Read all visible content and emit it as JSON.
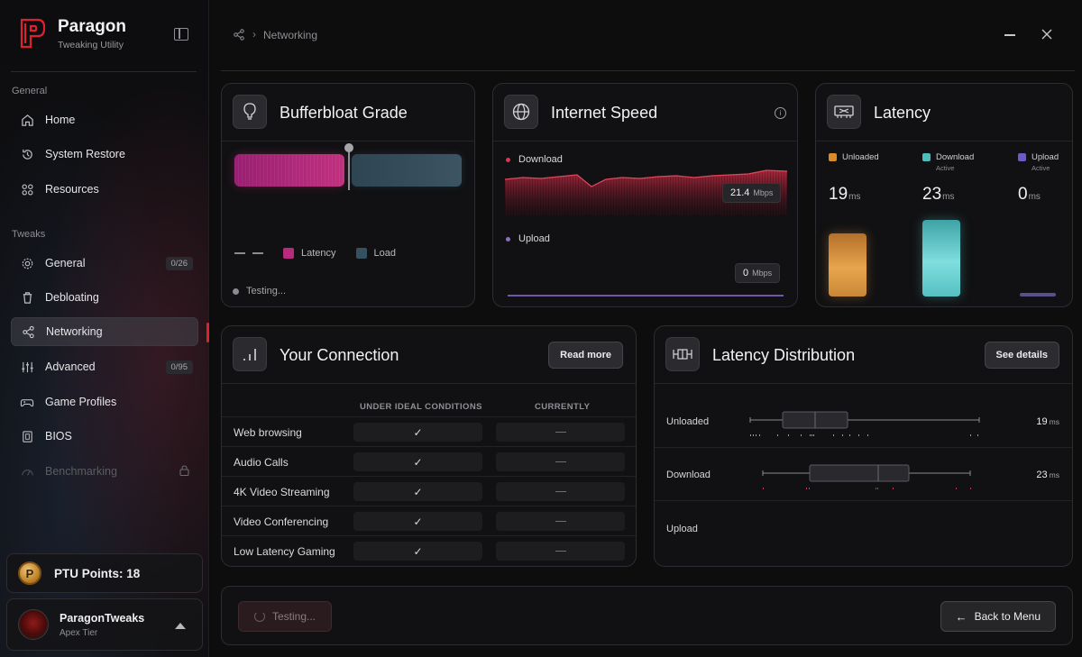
{
  "brand": {
    "title": "Paragon",
    "subtitle": "Tweaking Utility",
    "accent": "#e0212d"
  },
  "sidebar": {
    "sections": [
      {
        "label": "General"
      },
      {
        "label": "Tweaks"
      }
    ],
    "items": [
      {
        "label": "Home",
        "icon": "home-icon"
      },
      {
        "label": "System Restore",
        "icon": "restore-icon"
      },
      {
        "label": "Resources",
        "icon": "grid-icon"
      },
      {
        "label": "General",
        "icon": "gear-icon",
        "badge": "0/26"
      },
      {
        "label": "Debloating",
        "icon": "trash-icon"
      },
      {
        "label": "Networking",
        "icon": "share-icon",
        "active": true
      },
      {
        "label": "Advanced",
        "icon": "sliders-icon",
        "badge": "0/95"
      },
      {
        "label": "Game Profiles",
        "icon": "gamepad-icon"
      },
      {
        "label": "BIOS",
        "icon": "chip-icon"
      },
      {
        "label": "Benchmarking",
        "icon": "gauge-icon",
        "locked": true
      }
    ],
    "points": {
      "label": "PTU Points: 18",
      "coin": "P"
    },
    "user": {
      "name": "ParagonTweaks",
      "tier": "Apex Tier"
    }
  },
  "breadcrumb": {
    "icon": "share-icon",
    "separator": "›",
    "current": "Networking"
  },
  "bufferbloat": {
    "title": "Bufferbloat Grade",
    "legend": {
      "latency": "Latency",
      "load": "Load"
    },
    "status": "Testing...",
    "colors": {
      "latency": "#b72a7c",
      "load": "#35505e"
    }
  },
  "speed": {
    "title": "Internet Speed",
    "download": {
      "label": "Download",
      "value": "21.4",
      "unit": "Mbps",
      "color": "#e0344c"
    },
    "upload": {
      "label": "Upload",
      "value": "0",
      "unit": "Mbps",
      "color": "#8b6cc7"
    }
  },
  "latency": {
    "title": "Latency",
    "columns": [
      {
        "label": "Unloaded",
        "sub": "",
        "value": "19",
        "unit": "ms",
        "color": "#d98a2b"
      },
      {
        "label": "Download",
        "sub": "Active",
        "value": "23",
        "unit": "ms",
        "color": "#4fbcbc"
      },
      {
        "label": "Upload",
        "sub": "Active",
        "value": "0",
        "unit": "ms",
        "color": "#6b5bc4"
      }
    ]
  },
  "connection": {
    "title": "Your Connection",
    "read_more": "Read more",
    "col_ideal": "UNDER IDEAL CONDITIONS",
    "col_current": "CURRENTLY",
    "rows": [
      {
        "label": "Web browsing",
        "ideal": "✓"
      },
      {
        "label": "Audio Calls",
        "ideal": "✓"
      },
      {
        "label": "4K Video Streaming",
        "ideal": "✓"
      },
      {
        "label": "Video Conferencing",
        "ideal": "✓"
      },
      {
        "label": "Low Latency Gaming",
        "ideal": "✓"
      }
    ]
  },
  "distribution": {
    "title": "Latency Distribution",
    "see_details": "See details",
    "rows": [
      {
        "label": "Unloaded",
        "value": "19",
        "unit": "ms"
      },
      {
        "label": "Download",
        "value": "23",
        "unit": "ms"
      },
      {
        "label": "Upload",
        "value": "",
        "unit": ""
      }
    ]
  },
  "footer": {
    "testing": "Testing...",
    "back": "Back to Menu"
  }
}
